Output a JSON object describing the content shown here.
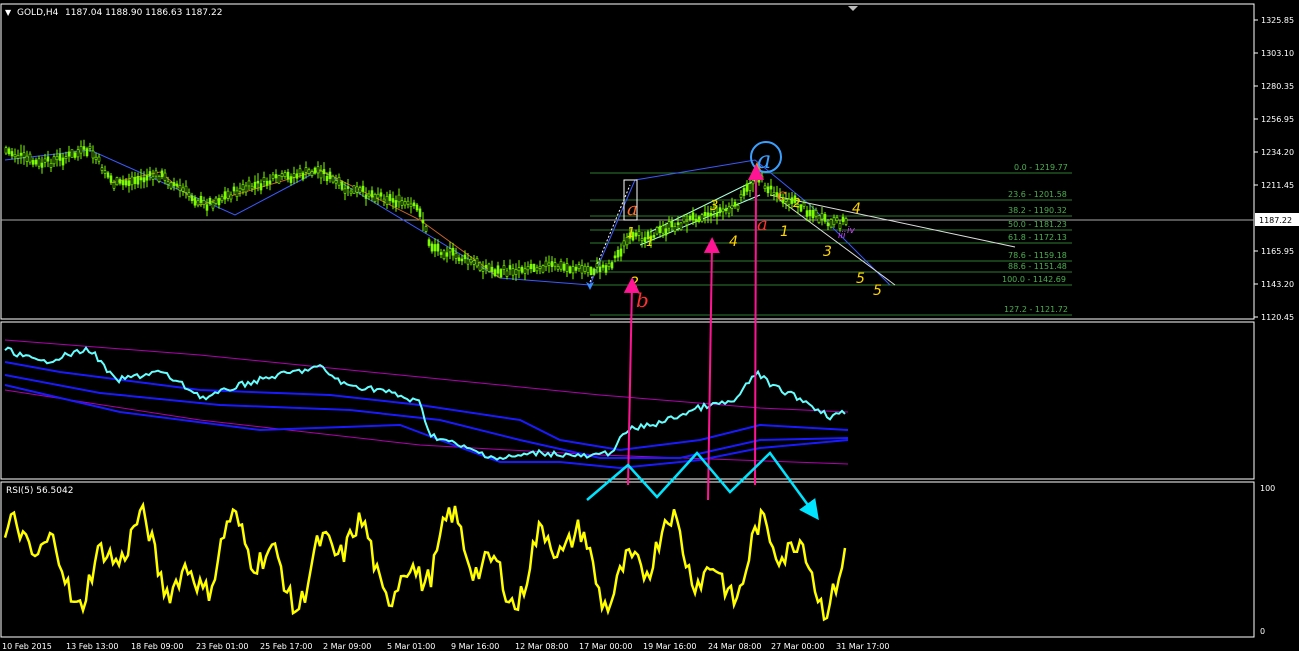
{
  "header": {
    "symbol_label": "GOLD,H4",
    "ohlc": "1187.04 1188.90 1186.63 1187.22",
    "menu_marker": "▼"
  },
  "price_axis": {
    "labels": [
      "1325.85",
      "1303.10",
      "1280.35",
      "1256.95",
      "1234.20",
      "1211.45",
      "1187.22",
      "1165.95",
      "1143.20",
      "1120.45"
    ],
    "current_price": "1187.22"
  },
  "fibonacci": {
    "levels": [
      {
        "label": "0.0 - 1219.77",
        "value": 1219.77
      },
      {
        "label": "23.6 - 1201.58",
        "value": 1201.58
      },
      {
        "label": "38.2 - 1190.32",
        "value": 1190.32
      },
      {
        "label": "50.0 - 1181.23",
        "value": 1181.23
      },
      {
        "label": "61.8 - 1172.13",
        "value": 1172.13
      },
      {
        "label": "78.6 - 1159.18",
        "value": 1159.18
      },
      {
        "label": "88.6 - 1151.48",
        "value": 1151.48
      },
      {
        "label": "100.0 - 1142.69",
        "value": 1142.69
      },
      {
        "label": "127.2 - 1121.72",
        "value": 1121.72
      }
    ]
  },
  "wave_labels": {
    "orange": [
      "a",
      "b",
      "c"
    ],
    "red": [
      "b",
      "a"
    ],
    "yellow": [
      "1",
      "2",
      "3",
      "4",
      "1",
      "3",
      "4",
      "5",
      "5"
    ],
    "blue_circled": "a",
    "magenta": [
      "iii",
      "iv"
    ]
  },
  "rsi": {
    "label": "RSI(5) 56.5042",
    "scale_top": "100",
    "scale_bottom": "0"
  },
  "time_axis": {
    "labels": [
      "10 Feb 2015",
      "13 Feb 13:00",
      "18 Feb 09:00",
      "23 Feb 01:00",
      "25 Feb 17:00",
      "2 Mar 09:00",
      "5 Mar 01:00",
      "9 Mar 16:00",
      "12 Mar 08:00",
      "17 Mar 00:00",
      "19 Mar 16:00",
      "24 Mar 08:00",
      "27 Mar 00:00",
      "31 Mar 17:00"
    ]
  },
  "colors": {
    "background": "#000000",
    "candle": "#7cfc00",
    "grid_line": "#ffffff",
    "fib": "#4caf50",
    "rsi": "#ffff00",
    "arrow_magenta": "#ff1493",
    "arrow_cyan": "#00e5ff",
    "bollinger": "#1a1aff",
    "envelope": "#b000b0"
  }
}
